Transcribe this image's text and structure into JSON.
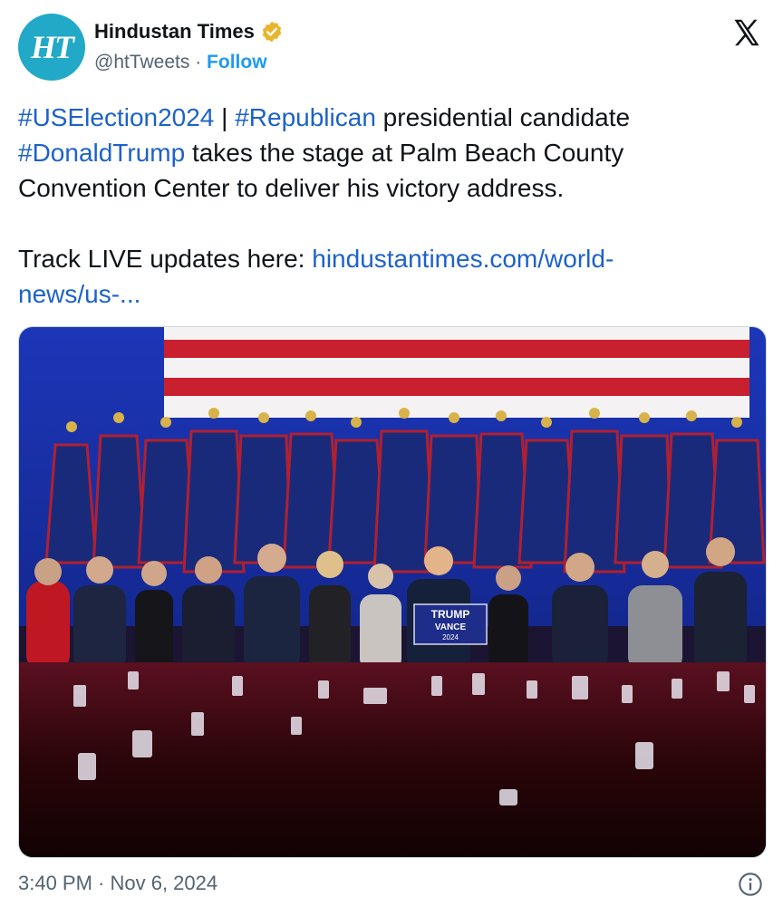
{
  "account": {
    "avatar_text": "HT",
    "name": "Hindustan Times",
    "handle": "@htTweets",
    "separator": "·",
    "follow_label": "Follow",
    "verified_color": "#e8b52c"
  },
  "tweet": {
    "line1_tag1": "#USElection2024",
    "line1_sep": " | ",
    "line1_tag2": "#Republican",
    "line1_rest": " presidential candidate",
    "line2_tag": "#DonaldTrump",
    "line2_rest": " takes the stage at Palm Beach County",
    "line3": "Convention Center to deliver his victory address.",
    "line5_text": "Track LIVE updates here: ",
    "link_part1": "hindustantimes.com/world-",
    "link_part2": "news/us-..."
  },
  "media": {
    "description_icon": "photo-stage",
    "podium_line1": "TRUMP",
    "podium_line2": "VANCE",
    "podium_line3": "2024"
  },
  "footer": {
    "timestamp": "3:40 PM · Nov 6, 2024",
    "info_icon": "info-icon"
  },
  "colors": {
    "brand": "#21a9c7",
    "link": "#1d62c9",
    "follow": "#1d9bf0"
  }
}
